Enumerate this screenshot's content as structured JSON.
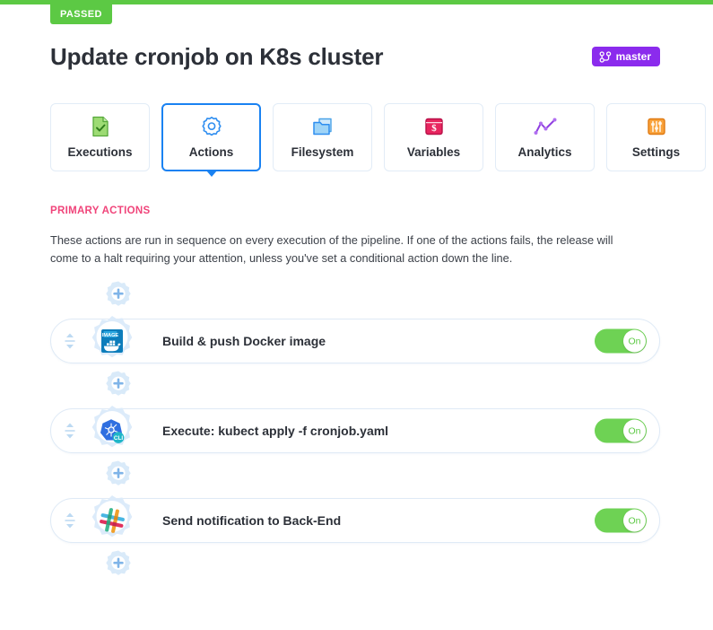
{
  "status": {
    "label": "PASSED",
    "color": "#5cc944"
  },
  "header": {
    "title": "Update cronjob on K8s cluster",
    "branch": {
      "label": "master",
      "icon": "branch-icon",
      "color": "#8b2bed"
    }
  },
  "tabs": [
    {
      "label": "Executions",
      "icon": "document-check-icon",
      "active": false
    },
    {
      "label": "Actions",
      "icon": "gear-icon",
      "active": true
    },
    {
      "label": "Filesystem",
      "icon": "folder-icon",
      "active": false
    },
    {
      "label": "Variables",
      "icon": "dollar-panel-icon",
      "active": false
    },
    {
      "label": "Analytics",
      "icon": "line-chart-icon",
      "active": false
    },
    {
      "label": "Settings",
      "icon": "sliders-icon",
      "active": false
    }
  ],
  "section": {
    "label": "PRIMARY ACTIONS",
    "label_color": "#f0447a",
    "description": "These actions are run in sequence on every execution of the pipeline. If one of the actions fails, the release will come to a halt requiring your attention, unless you've set a conditional action down the line."
  },
  "add_action": {
    "icon": "gear-plus-icon",
    "title": "Add action"
  },
  "actions": [
    {
      "name": "Build & push Docker image",
      "icon": "docker-image-icon",
      "drag_handle": "drag-handle-icon",
      "toggle": {
        "label": "On",
        "on": true
      }
    },
    {
      "name": "Execute: kubect apply -f cronjob.yaml",
      "icon": "kubernetes-cli-icon",
      "drag_handle": "drag-handle-icon",
      "toggle": {
        "label": "On",
        "on": true
      }
    },
    {
      "name": "Send notification to Back-End",
      "icon": "slack-icon",
      "drag_handle": "drag-handle-icon",
      "toggle": {
        "label": "On",
        "on": true
      }
    }
  ]
}
